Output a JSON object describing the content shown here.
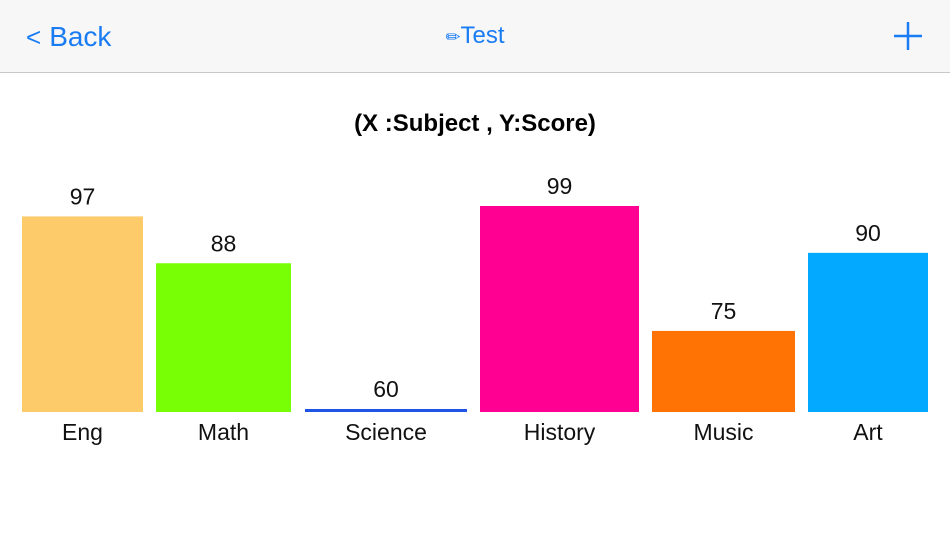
{
  "nav": {
    "back_label": "Back",
    "title_icon": "pencil-icon",
    "title_label": "Test",
    "add_icon": "plus-icon",
    "accent_color": "#1a7cf3"
  },
  "chart_data": {
    "type": "bar",
    "title": "(X :Subject , Y:Score)",
    "categories": [
      "Eng",
      "Math",
      "Science",
      "History",
      "Music",
      "Art"
    ],
    "values": [
      97,
      88,
      60,
      99,
      75,
      90
    ],
    "colors": [
      "#fdcb6a",
      "#78ff05",
      "#1f54e6",
      "#ff0093",
      "#ff7305",
      "#02a9ff"
    ],
    "grid": false,
    "legend": "none"
  }
}
